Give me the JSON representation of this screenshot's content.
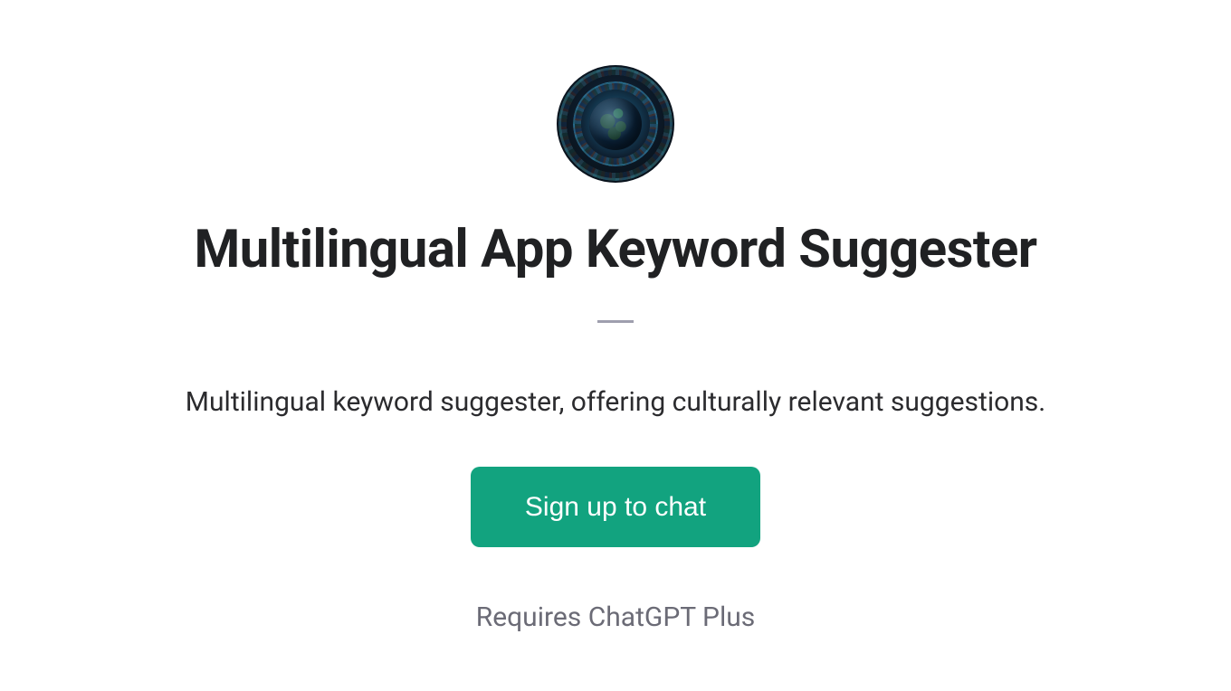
{
  "header": {
    "icon_name": "globe-languages-icon"
  },
  "title": "Multilingual App Keyword Suggester",
  "description": "Multilingual keyword suggester, offering culturally relevant suggestions.",
  "cta": {
    "label": "Sign up to chat"
  },
  "requirement": "Requires ChatGPT Plus",
  "colors": {
    "accent": "#12a37f",
    "text_primary": "#202123",
    "text_secondary": "#6b6b76",
    "divider": "#8e8ea0"
  }
}
